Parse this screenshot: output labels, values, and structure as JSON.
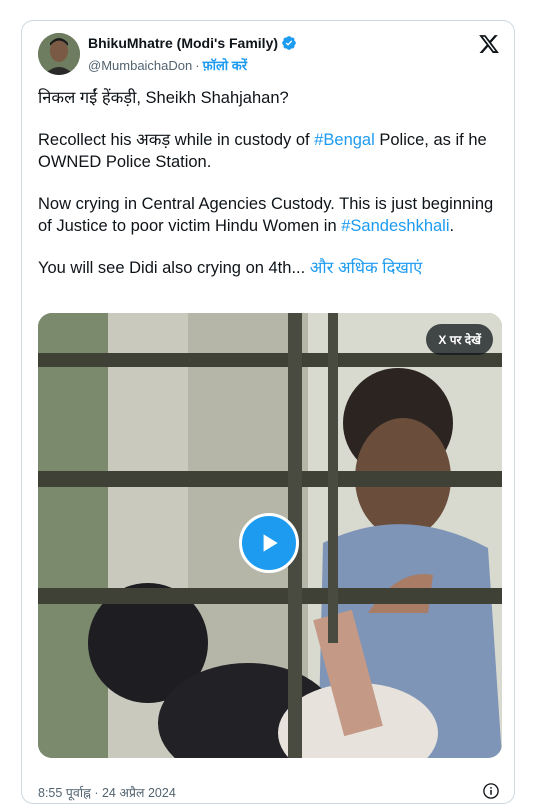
{
  "author": {
    "display_name": "BhikuMhatre (Modi's Family)",
    "handle": "@MumbaichaDon",
    "separator": "·",
    "follow_label": "फ़ॉलो करें"
  },
  "tweet": {
    "line1": "निकल गईं हेंकड़ी, Sheikh Shahjahan?",
    "p2_a": "Recollect his अकड़ while in custody of ",
    "p2_tag": "#Bengal",
    "p2_b": " Police, as if he OWNED Police Station.",
    "p3_a": "Now crying in Central Agencies Custody. This is just beginning of Justice to poor victim Hindu Women in ",
    "p3_tag": "#Sandeshkhali",
    "p3_b": ".",
    "p4_a": "You will see Didi also crying on 4th... ",
    "show_more": "और अधिक दिखाएं"
  },
  "media": {
    "view_on_x_label": "X पर देखें",
    "play_icon": "play-icon"
  },
  "footer": {
    "timestamp": "8:55 पूर्वाह्न · 24 अप्रैल 2024"
  },
  "colors": {
    "accent": "#1d9bf0",
    "secondary_text": "#536471",
    "border": "#cfd9de"
  }
}
